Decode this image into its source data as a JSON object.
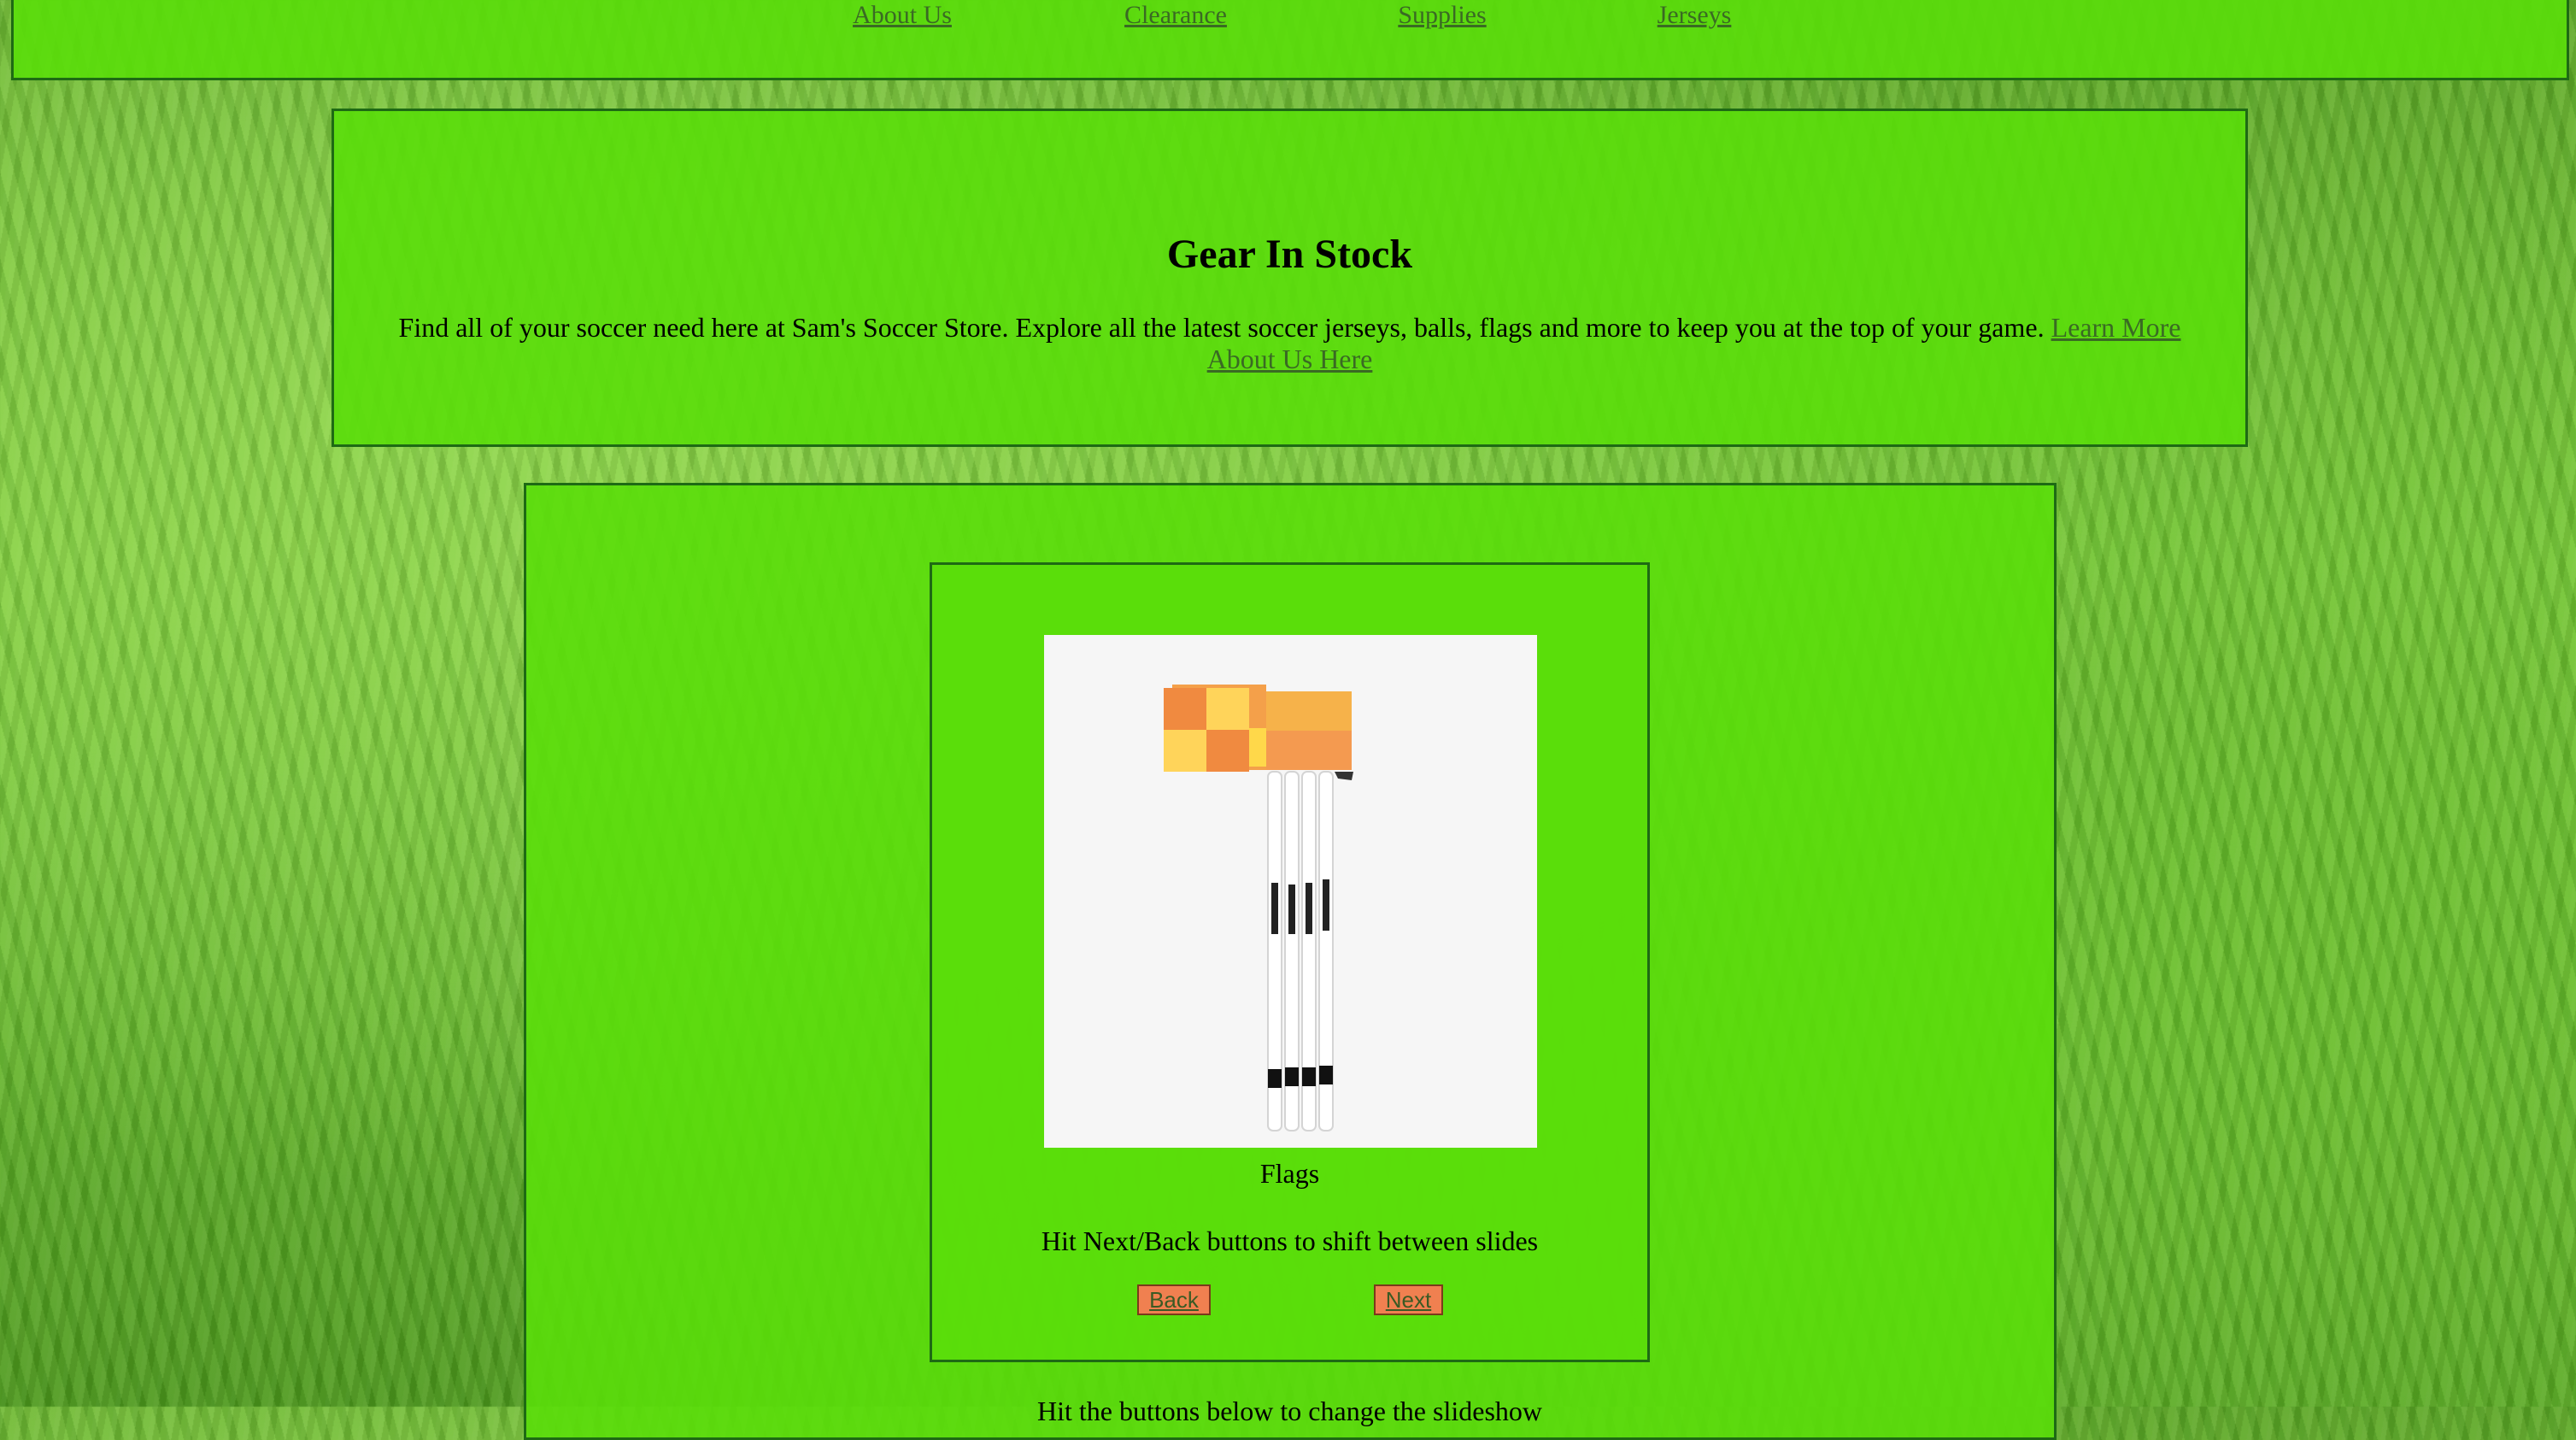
{
  "nav": {
    "links": [
      "About Us",
      "Clearance",
      "Supplies",
      "Jerseys"
    ]
  },
  "hero": {
    "title": "Gear In Stock",
    "text": "Find all of your soccer need here at Sam's Soccer Store. Explore all the latest soccer jerseys, balls, flags and more to keep you at the top of your game.",
    "link_text": "Learn More About Us Here"
  },
  "slideshow": {
    "caption": "Flags",
    "hint": "Hit Next/Back buttons to shift between slides",
    "back_label": "Back",
    "next_label": "Next",
    "hint_below": "Hit the buttons below to change the slideshow"
  },
  "colors": {
    "panel": "#5ade0a",
    "border": "#1e6a14",
    "link": "#3a6a24",
    "button": "#f08050"
  }
}
